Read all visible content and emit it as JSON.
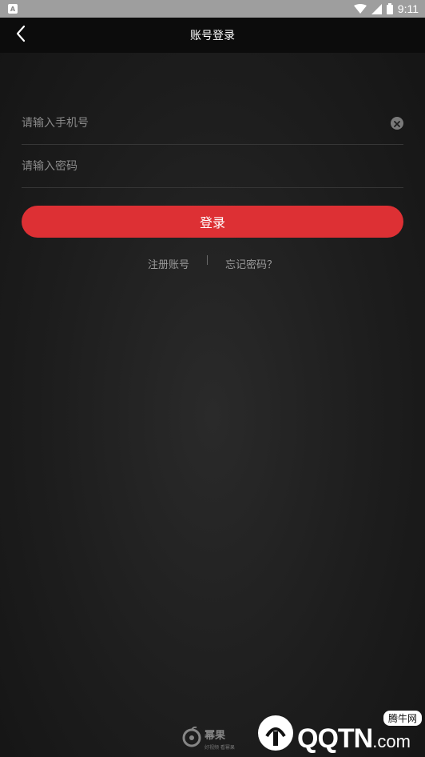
{
  "status_bar": {
    "app_icon_letter": "A",
    "time": "9:11"
  },
  "header": {
    "title": "账号登录"
  },
  "form": {
    "phone_placeholder": "请输入手机号",
    "phone_value": "",
    "password_placeholder": "请输入密码",
    "password_value": "",
    "login_label": "登录"
  },
  "links": {
    "register": "注册账号",
    "forgot": "忘记密码？"
  },
  "footer": {
    "brand_name": "幂果",
    "brand_slogan": "好视频 看幂果"
  },
  "watermark": {
    "main": "QQTN",
    "suffix": ".com",
    "badge": "腾牛网"
  },
  "colors": {
    "accent": "#dd3034",
    "title_bar": "#0c0c0c",
    "status_bar": "#9e9e9e"
  },
  "icons": [
    "app-notification-icon",
    "wifi-icon",
    "signal-icon",
    "battery-icon",
    "back-arrow-icon",
    "clear-input-icon",
    "brand-logo-icon",
    "watermark-logo-icon"
  ]
}
